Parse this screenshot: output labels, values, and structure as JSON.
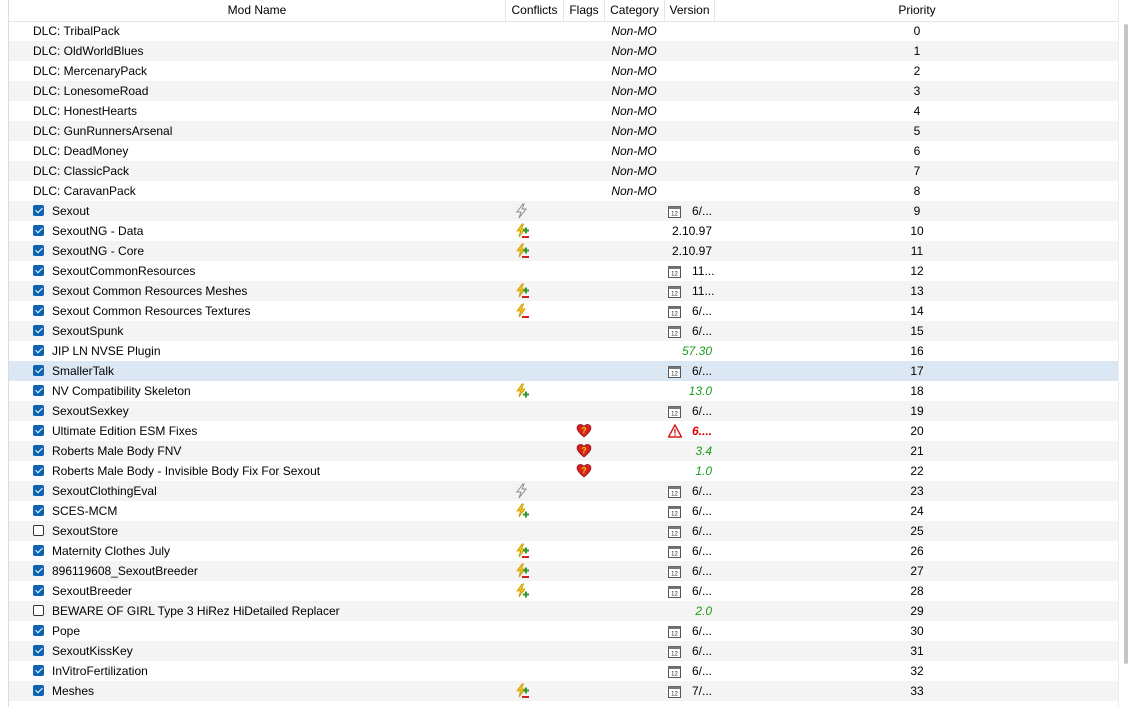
{
  "header": {
    "mod_name": "Mod Name",
    "conflicts": "Conflicts",
    "flags": "Flags",
    "category": "Category",
    "version": "Version",
    "priority": "Priority"
  },
  "rows": [
    {
      "name": "DLC: TribalPack",
      "type": "dlc",
      "category": "Non-MO",
      "priority": "0"
    },
    {
      "name": "DLC: OldWorldBlues",
      "type": "dlc",
      "category": "Non-MO",
      "priority": "1"
    },
    {
      "name": "DLC: MercenaryPack",
      "type": "dlc",
      "category": "Non-MO",
      "priority": "2"
    },
    {
      "name": "DLC: LonesomeRoad",
      "type": "dlc",
      "category": "Non-MO",
      "priority": "3"
    },
    {
      "name": "DLC: HonestHearts",
      "type": "dlc",
      "category": "Non-MO",
      "priority": "4"
    },
    {
      "name": "DLC: GunRunnersArsenal",
      "type": "dlc",
      "category": "Non-MO",
      "priority": "5"
    },
    {
      "name": "DLC: DeadMoney",
      "type": "dlc",
      "category": "Non-MO",
      "priority": "6"
    },
    {
      "name": "DLC: ClassicPack",
      "type": "dlc",
      "category": "Non-MO",
      "priority": "7"
    },
    {
      "name": "DLC: CaravanPack",
      "type": "dlc",
      "category": "Non-MO",
      "priority": "8"
    },
    {
      "name": "Sexout",
      "checked": true,
      "conflict": "lightning-gray-icon",
      "version": "6/...",
      "ver_style": "cal",
      "priority": "9"
    },
    {
      "name": "SexoutNG - Data",
      "checked": true,
      "conflict": "lightning-plus-minus-icon",
      "version": "2.10.97",
      "ver_style": "plain",
      "priority": "10"
    },
    {
      "name": "SexoutNG - Core",
      "checked": true,
      "conflict": "lightning-plus-minus-icon",
      "version": "2.10.97",
      "ver_style": "plain",
      "priority": "11"
    },
    {
      "name": "SexoutCommonResources",
      "checked": true,
      "version": "11...",
      "ver_style": "cal",
      "priority": "12"
    },
    {
      "name": "Sexout Common Resources Meshes",
      "checked": true,
      "conflict": "lightning-plus-minus-icon",
      "version": "11...",
      "ver_style": "cal",
      "priority": "13"
    },
    {
      "name": "Sexout Common Resources Textures",
      "checked": true,
      "conflict": "lightning-minus-icon",
      "version": "6/...",
      "ver_style": "cal",
      "priority": "14"
    },
    {
      "name": "SexoutSpunk",
      "checked": true,
      "version": "6/...",
      "ver_style": "cal",
      "priority": "15"
    },
    {
      "name": "JIP LN NVSE Plugin",
      "checked": true,
      "version": "57.30",
      "ver_style": "green",
      "priority": "16"
    },
    {
      "name": "SmallerTalk",
      "checked": true,
      "version": "6/...",
      "ver_style": "cal",
      "priority": "17",
      "selected": true
    },
    {
      "name": "NV Compatibility Skeleton",
      "checked": true,
      "conflict": "lightning-plus-icon",
      "version": "13.0",
      "ver_style": "green",
      "priority": "18"
    },
    {
      "name": "SexoutSexkey",
      "checked": true,
      "version": "6/...",
      "ver_style": "cal",
      "priority": "19"
    },
    {
      "name": "Ultimate Edition ESM Fixes",
      "checked": true,
      "flag": "heart-question-icon",
      "version": "6....",
      "ver_style": "red",
      "priority": "20"
    },
    {
      "name": "Roberts Male Body FNV",
      "checked": true,
      "flag": "heart-question-icon",
      "version": "3.4",
      "ver_style": "green",
      "priority": "21"
    },
    {
      "name": "Roberts Male Body - Invisible Body Fix For Sexout",
      "checked": true,
      "flag": "heart-question-icon",
      "version": "1.0",
      "ver_style": "green",
      "priority": "22"
    },
    {
      "name": "SexoutClothingEval",
      "checked": true,
      "conflict": "lightning-gray-icon",
      "version": "6/...",
      "ver_style": "cal",
      "priority": "23"
    },
    {
      "name": "SCES-MCM",
      "checked": true,
      "conflict": "lightning-plus-icon",
      "version": "6/...",
      "ver_style": "cal",
      "priority": "24"
    },
    {
      "name": "SexoutStore",
      "checked": false,
      "version": "6/...",
      "ver_style": "cal",
      "priority": "25"
    },
    {
      "name": "Maternity Clothes July",
      "checked": true,
      "conflict": "lightning-plus-minus-icon",
      "version": "6/...",
      "ver_style": "cal",
      "priority": "26"
    },
    {
      "name": "896119608_SexoutBreeder",
      "checked": true,
      "conflict": "lightning-plus-minus-icon",
      "version": "6/...",
      "ver_style": "cal",
      "priority": "27"
    },
    {
      "name": "SexoutBreeder",
      "checked": true,
      "conflict": "lightning-plus-icon",
      "version": "6/...",
      "ver_style": "cal",
      "priority": "28"
    },
    {
      "name": "BEWARE OF GIRL Type 3 HiRez HiDetailed Replacer",
      "checked": false,
      "version": "2.0",
      "ver_style": "green",
      "priority": "29"
    },
    {
      "name": "Pope",
      "checked": true,
      "version": "6/...",
      "ver_style": "cal",
      "priority": "30"
    },
    {
      "name": "SexoutKissKey",
      "checked": true,
      "version": "6/...",
      "ver_style": "cal",
      "priority": "31"
    },
    {
      "name": "InVitroFertilization",
      "checked": true,
      "version": "6/...",
      "ver_style": "cal",
      "priority": "32"
    },
    {
      "name": "Meshes",
      "checked": true,
      "conflict": "lightning-plus-minus-icon",
      "version": "7/...",
      "ver_style": "cal",
      "priority": "33"
    }
  ]
}
